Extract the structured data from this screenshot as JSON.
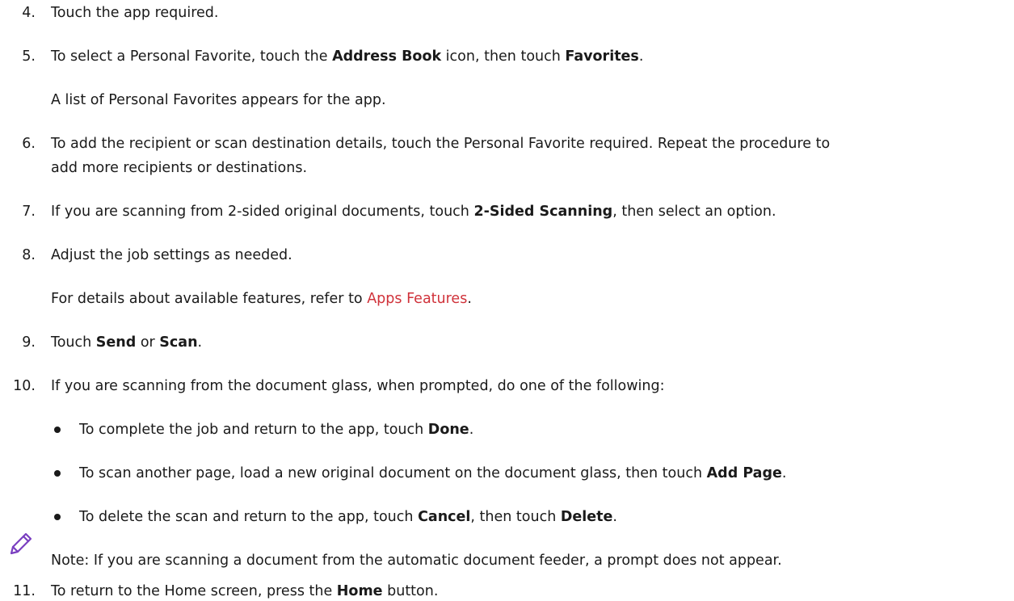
{
  "steps": [
    {
      "num": "4.",
      "parts": [
        "Touch the app required."
      ]
    },
    {
      "num": "5.",
      "parts": [
        "To select a Personal Favorite, touch the ",
        "Address Book",
        " icon, then touch ",
        "Favorites",
        "."
      ]
    },
    {
      "para": "A list of Personal Favorites appears for the app."
    },
    {
      "num": "6.",
      "parts": [
        "To add the recipient or scan destination details, touch the Personal Favorite required. Repeat the procedure to",
        "add more recipients or destinations."
      ]
    },
    {
      "num": "7.",
      "parts": [
        "If you are scanning from 2-sided original documents, touch ",
        "2-Sided Scanning",
        ", then select an option."
      ]
    },
    {
      "num": "8.",
      "parts": [
        "Adjust the job settings as needed."
      ]
    },
    {
      "para_parts": [
        "For details about available features, refer to ",
        "Apps Features",
        "."
      ]
    },
    {
      "num": "9.",
      "parts": [
        "Touch ",
        "Send",
        " or ",
        "Scan",
        "."
      ]
    },
    {
      "num": "10.",
      "parts": [
        "If you are scanning from the document glass, when prompted, do one of the following:"
      ]
    }
  ],
  "bullets": [
    [
      "To complete the job and return to the app, touch ",
      "Done",
      "."
    ],
    [
      "To scan another page, load a new original document on the document glass, then touch ",
      "Add Page",
      "."
    ],
    [
      "To delete the scan and return to the app, touch ",
      "Cancel",
      ", then touch ",
      "Delete",
      "."
    ]
  ],
  "note": {
    "icon": "pencil-icon",
    "text": "Note: If you are scanning a document from the automatic document feeder, a prompt does not appear."
  },
  "step11": {
    "num": "11.",
    "parts": [
      "To return to the Home screen, press the ",
      "Home",
      " button."
    ]
  },
  "colors": {
    "text": "#1a1a1a",
    "link": "#d0323a",
    "note_icon": "#7a3fc0"
  }
}
